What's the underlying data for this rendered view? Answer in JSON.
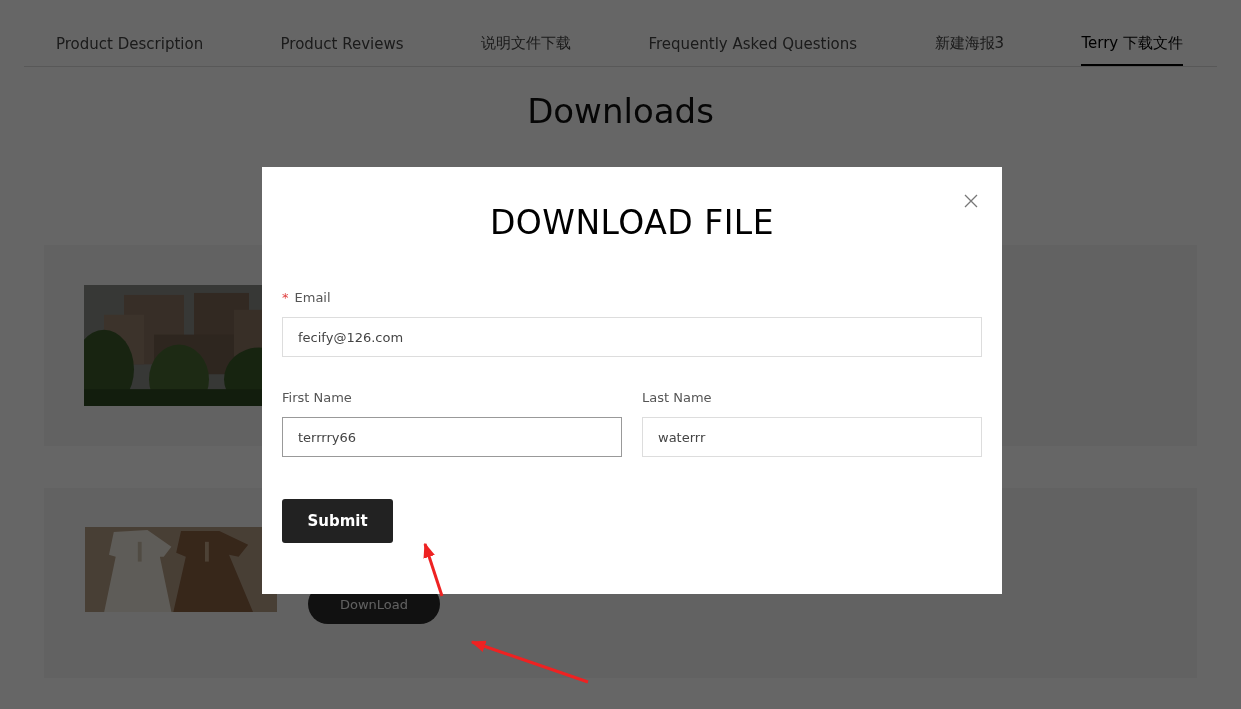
{
  "tabs": [
    {
      "label": "Product Description",
      "selected": false
    },
    {
      "label": "Product Reviews",
      "selected": false
    },
    {
      "label": "说明文件下载",
      "selected": false
    },
    {
      "label": "Frequently Asked Questions",
      "selected": false
    },
    {
      "label": "新建海报3",
      "selected": false
    },
    {
      "label": "Terry 下载文件",
      "selected": true
    }
  ],
  "heading": "Downloads",
  "downloads": [
    {
      "picture": {
        "kind": "picture"
      }
    },
    {
      "picture": {
        "kind": "picture"
      },
      "button": "DownLoad"
    }
  ],
  "dialog": {
    "title": "DOWNLOAD FILE",
    "fields": [
      {
        "marker": "*",
        "label": "Email",
        "value": "fecify@126.com",
        "focused": false
      },
      {
        "label": "First Name",
        "value": "terrrry66",
        "focused": true
      },
      {
        "label": "Last Name",
        "value": "waterrr",
        "focused": false
      }
    ],
    "submit": "Submit"
  }
}
